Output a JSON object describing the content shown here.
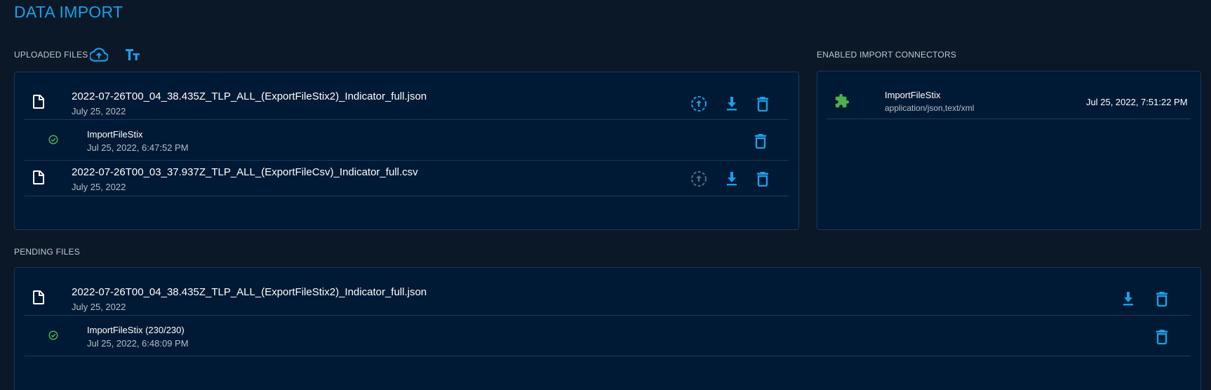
{
  "page": {
    "title": "DATA IMPORT"
  },
  "uploaded": {
    "label": "UPLOADED FILES",
    "files": [
      {
        "name": "2022-07-26T00_04_38.435Z_TLP_ALL_(ExportFileStix2)_Indicator_full.json",
        "date": "July 25, 2022",
        "works": [
          {
            "connector": "ImportFileStix",
            "date": "Jul 25, 2022, 6:47:52 PM"
          }
        ]
      },
      {
        "name": "2022-07-26T00_03_37.937Z_TLP_ALL_(ExportFileCsv)_Indicator_full.csv",
        "date": "July 25, 2022",
        "works": []
      }
    ]
  },
  "connectors": {
    "label": "ENABLED IMPORT CONNECTORS",
    "items": [
      {
        "name": "ImportFileStix",
        "scope": "application/json,text/xml",
        "updated": "Jul 25, 2022, 7:51:22 PM"
      }
    ]
  },
  "pending": {
    "label": "PENDING FILES",
    "files": [
      {
        "name": "2022-07-26T00_04_38.435Z_TLP_ALL_(ExportFileStix2)_Indicator_full.json",
        "date": "July 25, 2022",
        "works": [
          {
            "connector": "ImportFileStix (230/230)",
            "date": "Jul 25, 2022, 6:48:09 PM"
          }
        ]
      }
    ]
  },
  "colors": {
    "accent": "#1c9fe6",
    "success": "#4caf50",
    "disabled": "#5b6b7d",
    "background": "#0b1828",
    "panel": "#001a35"
  }
}
